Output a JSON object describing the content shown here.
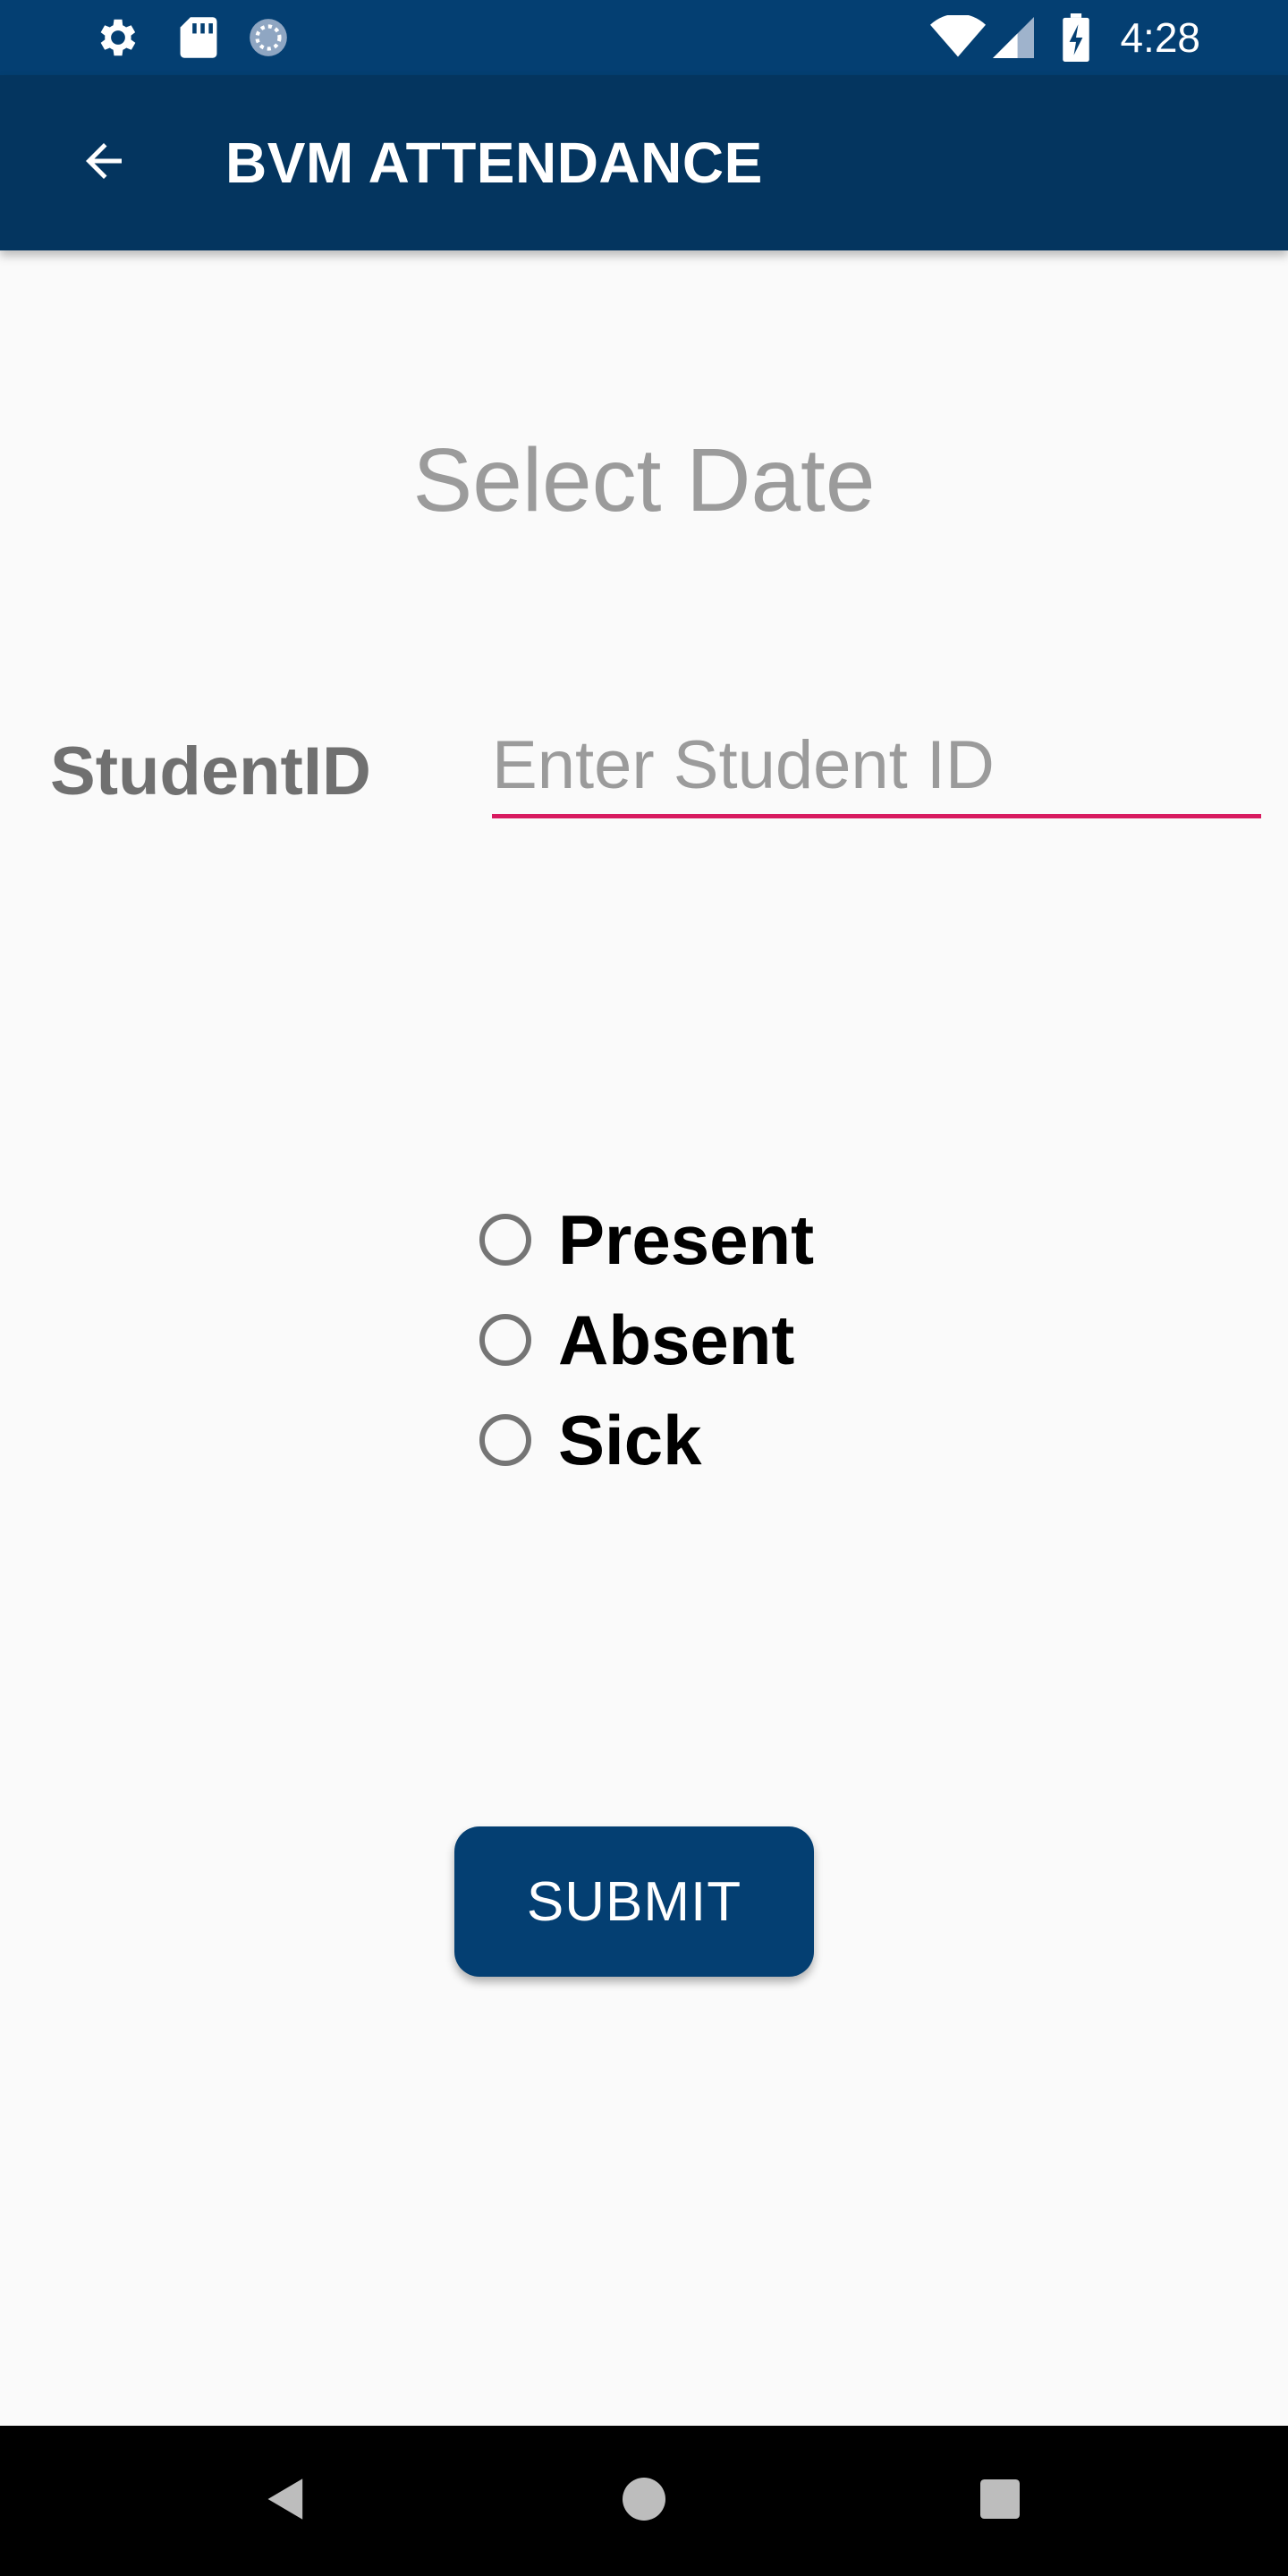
{
  "status_bar": {
    "time": "4:28",
    "icons": [
      "gear-icon",
      "sd-card-icon",
      "sync-icon",
      "wifi-icon",
      "signal-icon",
      "battery-charging-icon"
    ]
  },
  "app_bar": {
    "title": "BVM ATTENDANCE",
    "back_icon": "arrow-left-icon"
  },
  "date_picker": {
    "label": "Select Date"
  },
  "student_id": {
    "label": "StudentID",
    "placeholder": "Enter Student ID",
    "value": ""
  },
  "attendance_options": [
    {
      "label": "Present",
      "selected": false
    },
    {
      "label": "Absent",
      "selected": false
    },
    {
      "label": "Sick",
      "selected": false
    }
  ],
  "submit": {
    "label": "SUBMIT"
  },
  "nav_bar": {
    "icons": [
      "back-triangle-icon",
      "home-circle-icon",
      "recents-square-icon"
    ]
  },
  "colors": {
    "status_bar": "#043f72",
    "app_bar": "#04355f",
    "accent": "#d81b60",
    "button": "#043f72",
    "background": "#fafafa"
  }
}
